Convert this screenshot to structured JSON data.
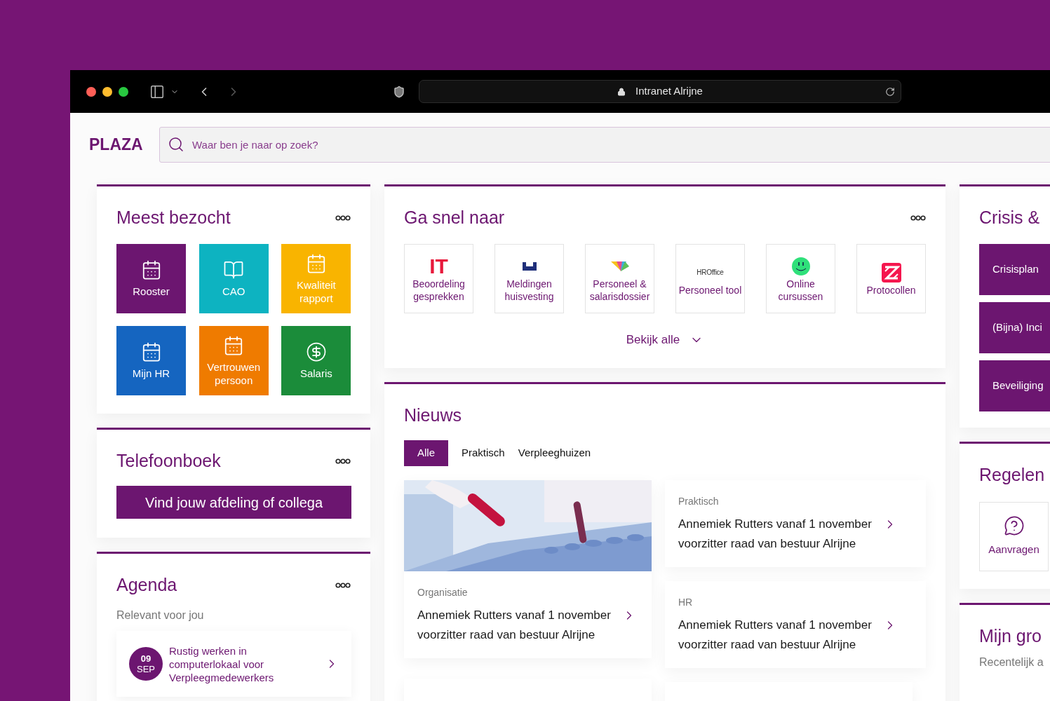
{
  "browser": {
    "address": "Intranet Alrijne"
  },
  "header": {
    "logo": "PLAZA",
    "search": {
      "placeholder": "Waar ben je naar op zoek?"
    }
  },
  "meest_bezocht": {
    "title": "Meest bezocht",
    "tiles": [
      {
        "label": "Rooster",
        "color": "#6c1670"
      },
      {
        "label": "CAO",
        "color": "#0db3c1"
      },
      {
        "label": "Kwaliteit rapport",
        "color": "#f9b400"
      },
      {
        "label": "Mijn HR",
        "color": "#1565c0"
      },
      {
        "label": "Vertrouwen persoon",
        "color": "#ef7b00"
      },
      {
        "label": "Salaris",
        "color": "#1b8c3a"
      }
    ]
  },
  "telefoonboek": {
    "title": "Telefoonboek",
    "button": "Vind jouw afdeling of collega"
  },
  "agenda": {
    "title": "Agenda",
    "subtitle": "Relevant voor jou",
    "events": [
      {
        "day": "09",
        "month": "SEP",
        "title": "Rustig werken in computerlokaal voor Verpleegmedewerkers"
      }
    ]
  },
  "ga_snel_naar": {
    "title": "Ga snel naar",
    "links": [
      {
        "label": "Beoordeling gesprekken",
        "logo_text": "IT"
      },
      {
        "label": "Meldingen huisvesting"
      },
      {
        "label": "Personeel & salarisdossier"
      },
      {
        "label": "Personeel tool",
        "logo_text": "HROffice"
      },
      {
        "label": "Online cursussen"
      },
      {
        "label": "Protocollen"
      }
    ],
    "more": "Bekijk alle"
  },
  "nieuws": {
    "title": "Nieuws",
    "tabs": [
      {
        "label": "Alle",
        "selected": true
      },
      {
        "label": "Praktisch",
        "selected": false
      },
      {
        "label": "Verpleeghuizen",
        "selected": false
      }
    ],
    "left": [
      {
        "category": "Organisatie",
        "title": "Annemiek Rutters vanaf 1 november voorzitter raad van bestuur Alrijne"
      }
    ],
    "right": [
      {
        "kind": "text",
        "category": "Praktisch",
        "title": "Annemiek Rutters vanaf 1 november voorzitter raad van bestuur Alrijne"
      },
      {
        "kind": "text",
        "category": "HR",
        "title": "Annemiek Rutters vanaf 1 november voorzitter raad van bestuur Alrijne"
      }
    ]
  },
  "crisis": {
    "title": "Crisis &",
    "buttons": [
      "Crisisplan",
      "(Bijna) Inci",
      "Beveiliging"
    ]
  },
  "regelen": {
    "title": "Regelen",
    "tiles": [
      {
        "label": "Aanvragen"
      }
    ]
  },
  "mijn_groep": {
    "title": "Mijn gro",
    "subtitle": "Recentelijk a"
  }
}
